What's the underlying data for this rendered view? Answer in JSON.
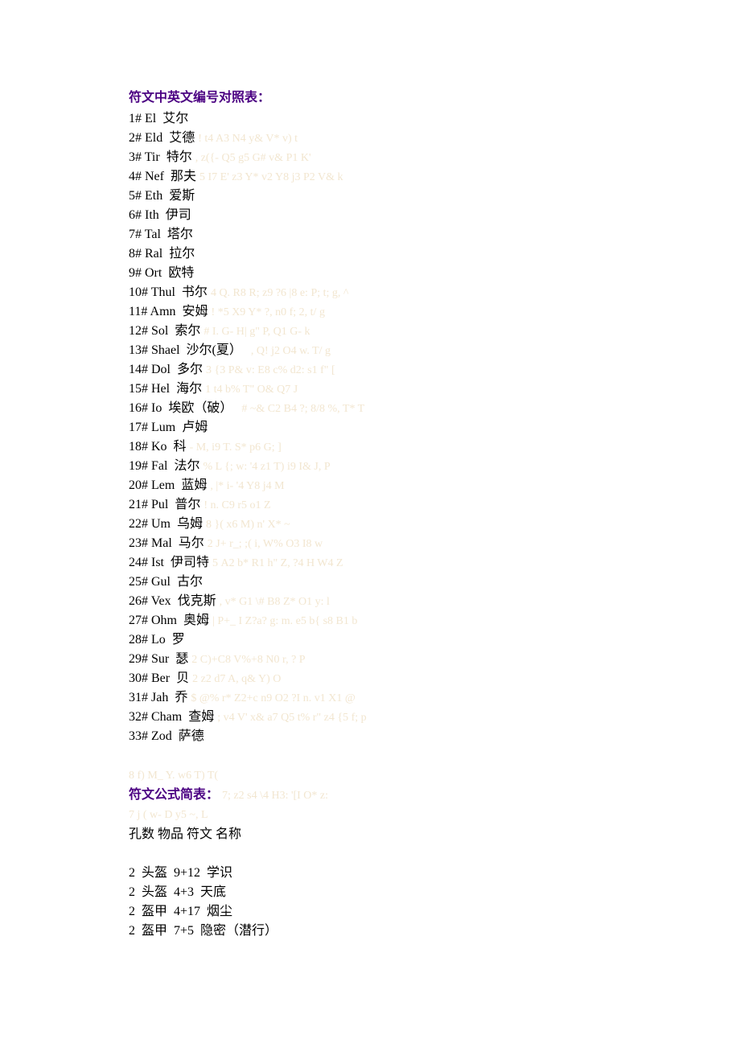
{
  "section1_title": "符文中英文编号对照表：",
  "runes": [
    {
      "num": "1#",
      "en": "El",
      "cn": "艾尔",
      "wm": ""
    },
    {
      "num": "2#",
      "en": "Eld",
      "cn": "艾德",
      "wm": "! t4 A3 N4 y& V* v) t"
    },
    {
      "num": "3#",
      "en": "Tir",
      "cn": "特尔",
      "wm": ", z({- Q5 g5 G# v& P1 K'"
    },
    {
      "num": "4#",
      "en": "Nef",
      "cn": "那夫",
      "wm": "5 I7 E' z3 Y* v2 Y8 j3 P2 V& k"
    },
    {
      "num": "5#",
      "en": "Eth",
      "cn": "爱斯",
      "wm": ""
    },
    {
      "num": "6#",
      "en": "Ith",
      "cn": "伊司",
      "wm": ""
    },
    {
      "num": "7#",
      "en": "Tal",
      "cn": "塔尔",
      "wm": ""
    },
    {
      "num": "8#",
      "en": "Ral",
      "cn": "拉尔",
      "wm": ""
    },
    {
      "num": "9#",
      "en": "Ort",
      "cn": "欧特",
      "wm": ""
    },
    {
      "num": "10#",
      "en": "Thul",
      "cn": "书尔",
      "wm": "4 Q. R8 R; z9 ?6 |8 e: P; t; g, ^"
    },
    {
      "num": "11#",
      "en": "Amn",
      "cn": "安姆",
      "wm": "! *5 X9 Y* ?, n0 f; 2, t/ g"
    },
    {
      "num": "12#",
      "en": "Sol",
      "cn": "索尔",
      "wm": "# I. G- H| g\" P, Q1 G- k"
    },
    {
      "num": "13#",
      "en": "Shael",
      "cn": "沙尔(夏）",
      "wm": "  , Q! j2 O4 w. T/ g"
    },
    {
      "num": "14#",
      "en": "Dol",
      "cn": "多尔",
      "wm": "3 {3 P& v: E8 c% d2: s1 f\" ["
    },
    {
      "num": "15#",
      "en": "Hel",
      "cn": "海尔",
      "wm": "1 t4 b% T\" O& Q7 J"
    },
    {
      "num": "16#",
      "en": "Io",
      "cn": "埃欧（破）",
      "wm": "  # ~& C2 B4 ?; 8/8 %, T* T"
    },
    {
      "num": "17#",
      "en": "Lum",
      "cn": "卢姆",
      "wm": ""
    },
    {
      "num": "18#",
      "en": "Ko",
      "cn": "科",
      "wm": "- M, i9 T. S* p6 G; ]"
    },
    {
      "num": "19#",
      "en": "Fal",
      "cn": "法尔",
      "wm": "% L {; w: '4 z1 T) i9 I& J, P"
    },
    {
      "num": "20#",
      "en": "Lem",
      "cn": "蓝姆",
      "wm": ", |* i- '4 Y8 j4 M"
    },
    {
      "num": "21#",
      "en": "Pul",
      "cn": "普尔",
      "wm": "! n. C9 r5 o1 Z"
    },
    {
      "num": "22#",
      "en": "Um",
      "cn": "乌姆",
      "wm": "8 }( x6 M) n' X* ~"
    },
    {
      "num": "23#",
      "en": "Mal",
      "cn": "马尔",
      "wm": "2 J+ r_; ;( i, W% O3 I8 w"
    },
    {
      "num": "24#",
      "en": "Ist",
      "cn": "伊司特",
      "wm": "5 A2 b* R1 h\" Z, ?4 H W4 Z"
    },
    {
      "num": "25#",
      "en": "Gul",
      "cn": "古尔",
      "wm": ""
    },
    {
      "num": "26#",
      "en": "Vex",
      "cn": "伐克斯",
      "wm": ", v* G1 \\# B8 Z* O1 y: l"
    },
    {
      "num": "27#",
      "en": "Ohm",
      "cn": "奥姆",
      "wm": "| P+_ I Z?a? g: m. e5 b{ s8 B1 b"
    },
    {
      "num": "28#",
      "en": "Lo",
      "cn": "罗",
      "wm": ""
    },
    {
      "num": "29#",
      "en": "Sur",
      "cn": "瑟",
      "wm": "2 C)+C8 V%+8 N0 r, ? P"
    },
    {
      "num": "30#",
      "en": "Ber",
      "cn": "贝",
      "wm": "2 z2 d7 A, q& Y) O"
    },
    {
      "num": "31#",
      "en": "Jah",
      "cn": "乔",
      "wm": "$ @% r* Z2+c n9 O2 ?I n. v1 X1 @"
    },
    {
      "num": "32#",
      "en": "Cham",
      "cn": "查姆",
      "wm": "; v4 V' x& a7 Q5 t% r\" z4 {5 f; p"
    },
    {
      "num": "33#",
      "en": "Zod",
      "cn": "萨德",
      "wm": ""
    }
  ],
  "faint1": "8 f) M_ Y. w6 T) T(",
  "section2_title": "符文公式简表：",
  "section2_wm": "7; z2 s4 \\4 H3: '[I O* z:",
  "faint2": "7 j ( w- D y5 ~, L",
  "formula_header": "孔数  物品  符文  名称",
  "formulas": [
    {
      "holes": "2",
      "item": "头盔",
      "recipe": "9+12",
      "name": "学识"
    },
    {
      "holes": "2",
      "item": "头盔",
      "recipe": "4+3",
      "name": "天底"
    },
    {
      "holes": "2",
      "item": "盔甲",
      "recipe": "4+17",
      "name": "烟尘"
    },
    {
      "holes": "2",
      "item": "盔甲",
      "recipe": "7+5",
      "name": "隐密（潜行）"
    }
  ]
}
